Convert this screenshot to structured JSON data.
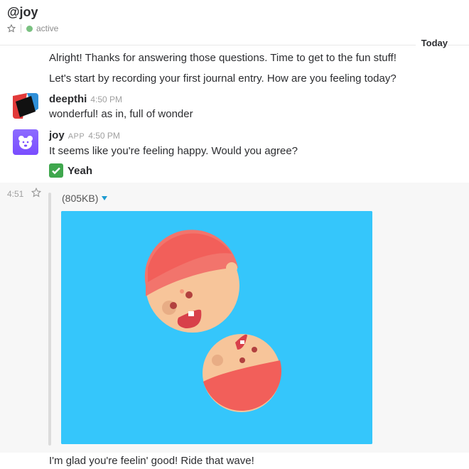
{
  "header": {
    "title": "@joy",
    "status": "active"
  },
  "day_divider": "Today",
  "messages": {
    "intro_1": "Alright! Thanks for answering those questions. Time to get to the fun stuff!",
    "intro_2": "Let's start by recording your first journal entry. How are you feeling today?",
    "deepthi": {
      "sender": "deepthi",
      "time": "4:50 PM",
      "text": "wonderful! as in, full of wonder"
    },
    "joy": {
      "sender": "joy",
      "badge": "APP",
      "time": "4:50 PM",
      "text": "It seems like you're feeling happy. Would you agree?",
      "button_label": "Yeah"
    },
    "attachment": {
      "gutter_time": "4:51",
      "file_size": "(805KB)"
    },
    "final": "I'm glad you're feelin' good! Ride that wave!"
  },
  "colors": {
    "presence": "#7ac181",
    "image_bg": "#35c6fb",
    "link_blue": "#1d9bd1"
  }
}
